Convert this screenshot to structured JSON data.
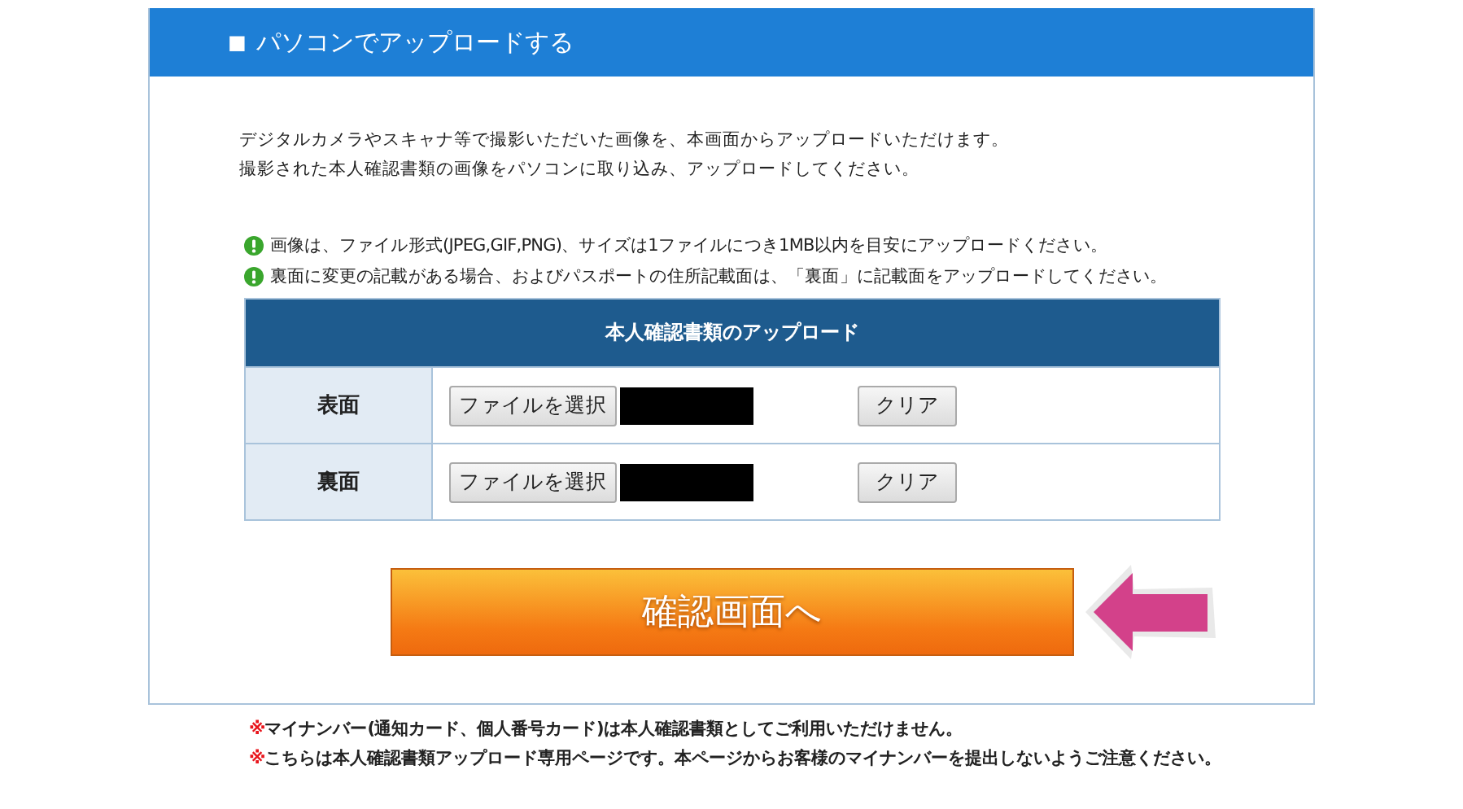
{
  "panel": {
    "title": "パソコンでアップロードする",
    "title_mark": "■"
  },
  "intro": [
    "デジタルカメラやスキャナ等で撮影いただいた画像を、本画面からアップロードいただけます。",
    "撮影された本人確認書類の画像をパソコンに取り込み、アップロードしてください。"
  ],
  "hints": [
    "画像は、ファイル形式(JPEG,GIF,PNG)、サイズは1ファイルにつき1MB以内を目安にアップロードください。",
    "裏面に変更の記載がある場合、およびパスポートの住所記載面は、「裏面」に記載面をアップロードしてください。"
  ],
  "upload_table": {
    "title": "本人確認書類のアップロード",
    "rows": [
      {
        "label": "表面",
        "choose_button": "ファイルを選択",
        "clear_button": "クリア"
      },
      {
        "label": "裏面",
        "choose_button": "ファイルを選択",
        "clear_button": "クリア"
      }
    ]
  },
  "submit_button": "確認画面へ",
  "notes": [
    {
      "mark": "※",
      "text": "マイナンバー(通知カード、個人番号カード)は本人確認書類としてご利用いただけません。"
    },
    {
      "mark": "※",
      "text": "こちらは本人確認書類アップロード専用ページです。本ページからお客様のマイナンバーを提出しないようご注意ください。"
    }
  ]
}
